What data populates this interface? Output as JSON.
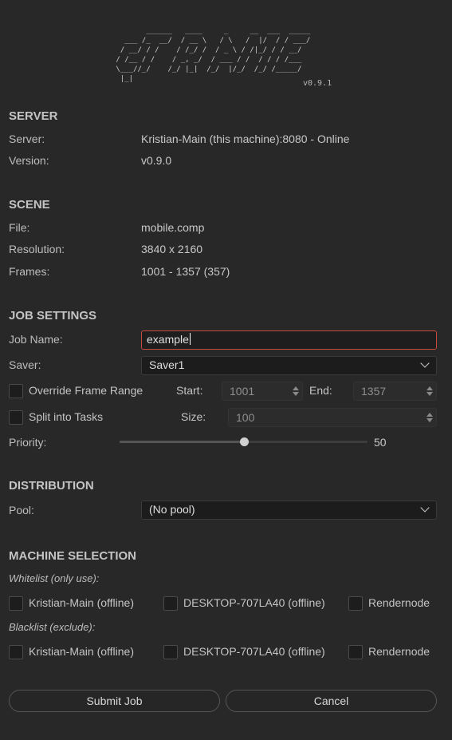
{
  "header": {
    "logo_ascii": "        ______   ____     _     __  ___  _____\n   ___ /_  __/  / __ \\   / \\   /  |/  / / ___/\n  / __/ / /    / /_/ /  / _ \\ / /|_/ / / __/  \n / /__ / /    / _, _/  / ___ / /  / / / /___  \n \\___//_/    /_/ |_|  /_/  |/_/  /_/ /_____/  \n  |_|",
    "version_tag": "v0.9.1"
  },
  "server": {
    "title": "SERVER",
    "server_label": "Server:",
    "server_value": "Kristian-Main (this machine):8080 - Online",
    "version_label": "Version:",
    "version_value": "v0.9.0"
  },
  "scene": {
    "title": "SCENE",
    "file_label": "File:",
    "file_value": "mobile.comp",
    "resolution_label": "Resolution:",
    "resolution_value": "3840 x 2160",
    "frames_label": "Frames:",
    "frames_value": "1001 - 1357 (357)"
  },
  "job_settings": {
    "title": "JOB SETTINGS",
    "job_name_label": "Job Name:",
    "job_name_value": "example",
    "saver_label": "Saver:",
    "saver_value": "Saver1",
    "override_label": "Override Frame Range",
    "override_checked": false,
    "start_label": "Start:",
    "start_value": "1001",
    "end_label": "End:",
    "end_value": "1357",
    "split_label": "Split into Tasks",
    "split_checked": false,
    "size_label": "Size:",
    "size_value": "100",
    "priority_label": "Priority:",
    "priority_value": "50",
    "priority_max": 100
  },
  "distribution": {
    "title": "DISTRIBUTION",
    "pool_label": "Pool:",
    "pool_value": "(No pool)"
  },
  "machine_selection": {
    "title": "MACHINE SELECTION",
    "whitelist_label": "Whitelist (only use):",
    "whitelist": [
      {
        "label": "Kristian-Main (offline)",
        "checked": false
      },
      {
        "label": "DESKTOP-707LA40 (offline)",
        "checked": false
      },
      {
        "label": "Rendernode",
        "checked": false
      }
    ],
    "blacklist_label": "Blacklist (exclude):",
    "blacklist": [
      {
        "label": "Kristian-Main (offline)",
        "checked": false
      },
      {
        "label": "DESKTOP-707LA40 (offline)",
        "checked": false
      },
      {
        "label": "Rendernode",
        "checked": false
      }
    ]
  },
  "actions": {
    "submit_label": "Submit Job",
    "cancel_label": "Cancel"
  },
  "colors": {
    "background": "#282828",
    "active_border": "#c94a3e",
    "text": "#c8c8c8"
  }
}
